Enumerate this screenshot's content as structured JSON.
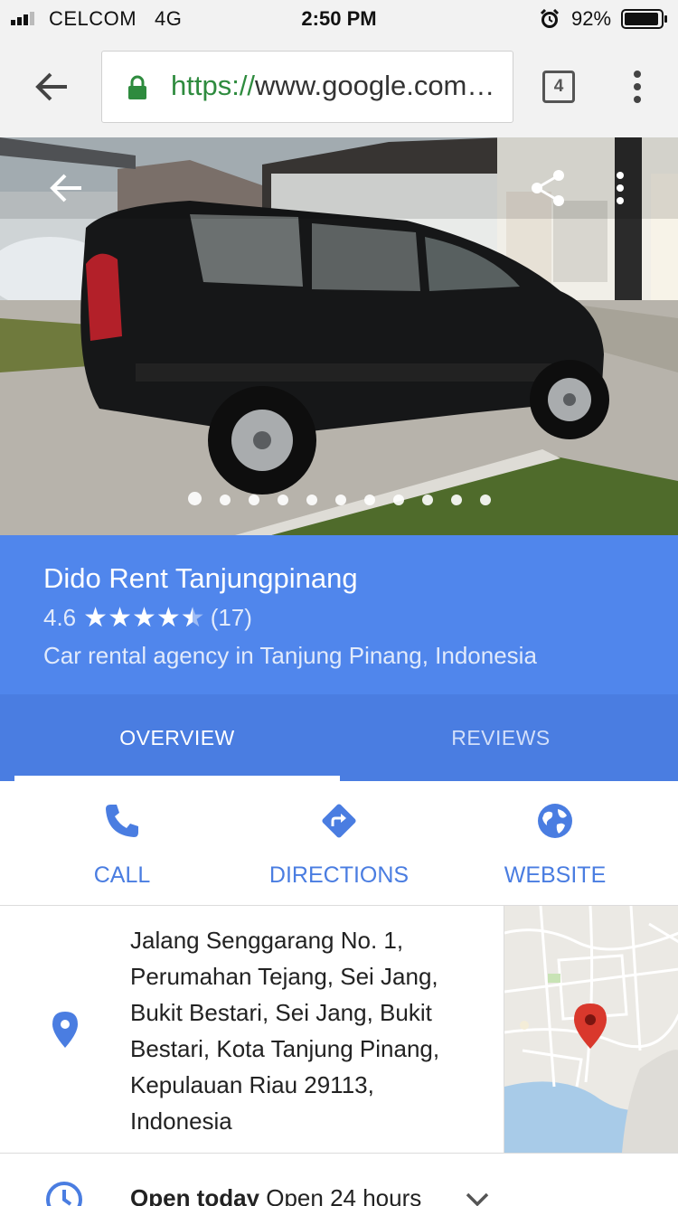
{
  "status_bar": {
    "carrier": "CELCOM",
    "network": "4G",
    "time": "2:50 PM",
    "battery": "92%",
    "icons": [
      "signal-icon",
      "alarm-icon",
      "battery-icon"
    ]
  },
  "browser": {
    "url_scheme": "https://",
    "url_host": "www.google.com…",
    "tab_count": "4",
    "icons": [
      "back-arrow-icon",
      "lock-icon",
      "overflow-menu-icon"
    ]
  },
  "hero": {
    "photo_count": 11,
    "active_photo": 1,
    "icons": [
      "back-arrow-icon",
      "share-icon",
      "more-vert-icon"
    ]
  },
  "place": {
    "name": "Dido Rent Tanjungpinang",
    "rating": "4.6",
    "rating_value": 4.6,
    "review_count": "(17)",
    "type": "Car rental agency in Tanjung Pinang, Indonesia"
  },
  "tabs": [
    {
      "label": "OVERVIEW",
      "active": true
    },
    {
      "label": "REVIEWS",
      "active": false
    }
  ],
  "actions": [
    {
      "label": "CALL",
      "icon": "phone-icon"
    },
    {
      "label": "DIRECTIONS",
      "icon": "directions-icon"
    },
    {
      "label": "WEBSITE",
      "icon": "globe-icon"
    }
  ],
  "address": {
    "lines": [
      "Jalang Senggarang No. 1,",
      "Perumahan Tejang, Sei Jang,",
      "Bukit Bestari, Sei Jang, Bukit",
      "Bestari, Kota Tanjung Pinang,",
      "Kepulauan Riau 29113,",
      "Indonesia"
    ],
    "icon": "location-pin-icon"
  },
  "hours": {
    "status": "Open today",
    "detail": " Open 24 hours",
    "icon": "clock-icon"
  },
  "colors": {
    "header_blue": "#5086ec",
    "tab_blue": "#4a7de1",
    "action_blue": "#4a7de1",
    "map_pin_red": "#d9382c"
  }
}
